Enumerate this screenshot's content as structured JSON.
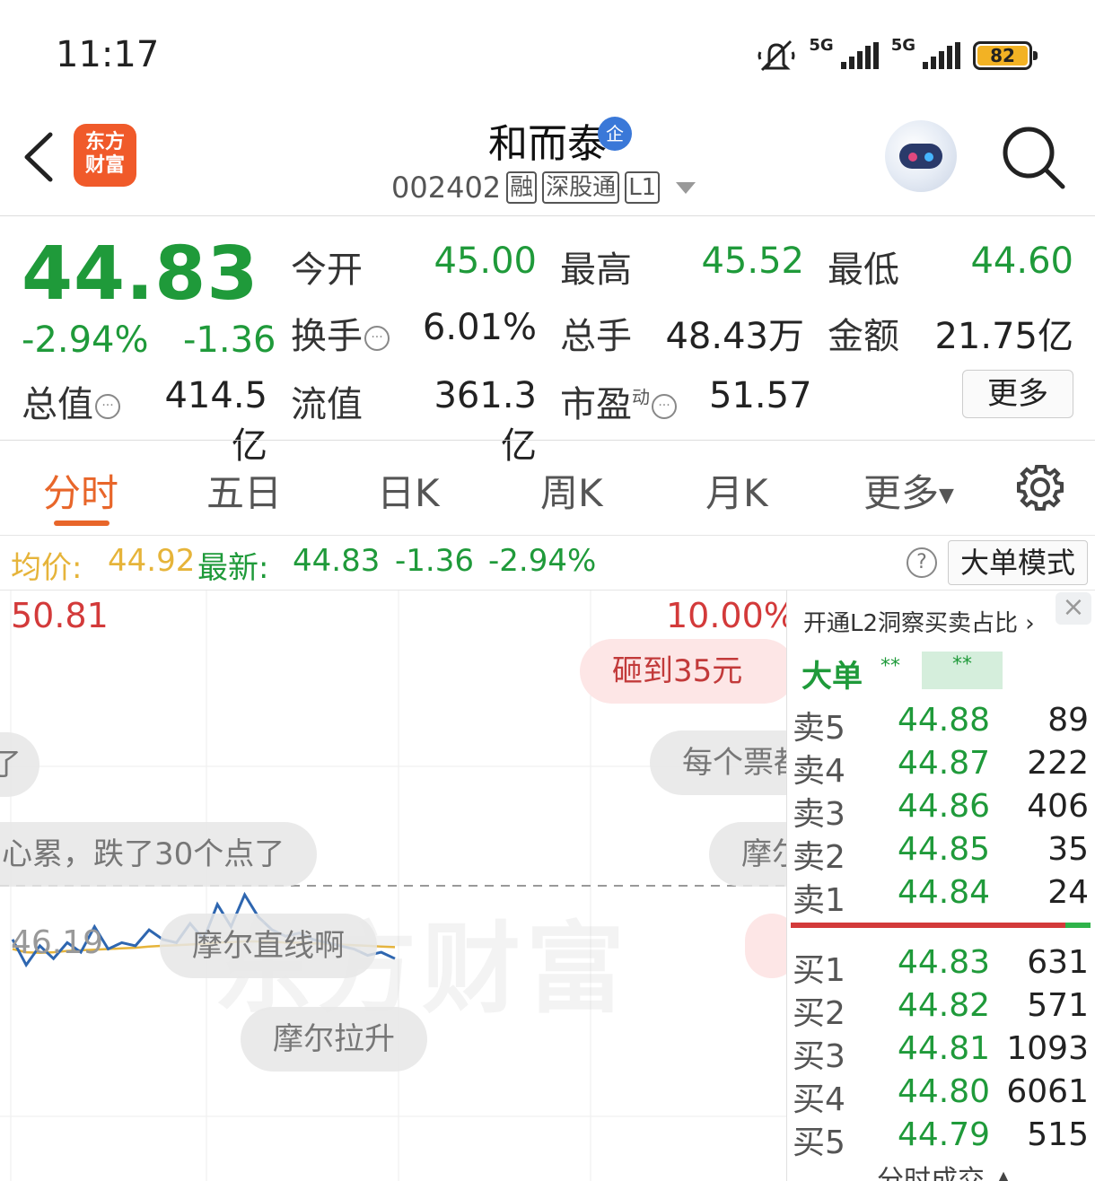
{
  "status": {
    "time": "11:17",
    "net1": "5G",
    "net2": "5G",
    "battery": "82"
  },
  "header": {
    "app_logo": "东方\n财富",
    "stock_name": "和而泰",
    "badge": "企",
    "code": "002402",
    "tags": [
      "融",
      "深股通",
      "L1"
    ]
  },
  "quote": {
    "price": "44.83",
    "pct": "-2.94%",
    "chg": "-1.36",
    "fields": [
      {
        "label": "今开",
        "value": "45.00"
      },
      {
        "label": "最高",
        "value": "45.52"
      },
      {
        "label": "最低",
        "value": "44.60"
      },
      {
        "label": "换手",
        "value": "6.01%"
      },
      {
        "label": "总手",
        "value": "48.43万"
      },
      {
        "label": "金额",
        "value": "21.75亿"
      },
      {
        "label": "总值",
        "value": "414.5亿"
      },
      {
        "label": "流值",
        "value": "361.3亿"
      },
      {
        "label": "市盈",
        "value": "51.57",
        "sup": "动"
      }
    ],
    "more": "更多"
  },
  "tabs": [
    "分时",
    "五日",
    "日K",
    "周K",
    "月K",
    "更多"
  ],
  "infobar": {
    "avg_label": "均价:",
    "avg_value": "44.92",
    "latest_label": "最新:",
    "latest_value": "44.83",
    "chg": "-1.36",
    "pct": "-2.94%",
    "help": "?",
    "bigorder_mode": "大单模式"
  },
  "chart": {
    "top_price": "50.81",
    "top_pct": "10.00%",
    "ref_price": "46.19",
    "watermark": "东方财富",
    "bubbles": [
      "砸到35元",
      "每个票都",
      "心累，跌了30个点了",
      "摩尔直线啊",
      "摩尔",
      "摩尔拉升",
      "了"
    ]
  },
  "chart_data": {
    "type": "line",
    "series": [
      {
        "values": [
          45.35,
          44.95,
          45.25,
          45.05,
          45.3,
          45.15,
          45.55,
          45.2,
          45.3,
          45.25,
          45.5,
          45.35,
          45.3,
          45.6,
          45.35,
          45.9,
          45.55,
          46.05,
          45.7,
          45.5,
          45.4,
          45.45,
          45.35,
          45.3,
          45.25,
          45.2,
          45.1,
          45.15,
          45.05
        ]
      },
      {
        "values": [
          45.2,
          45.15,
          45.14,
          45.15,
          45.17,
          45.18,
          45.19,
          45.2,
          45.21,
          45.22,
          45.24,
          45.25,
          45.26,
          45.27,
          45.28,
          45.3,
          45.31,
          45.32,
          45.32,
          45.32,
          45.3,
          45.3,
          45.29,
          45.28,
          45.27,
          45.26,
          45.25,
          45.24,
          45.23
        ]
      }
    ],
    "ylim": [
      41.57,
      50.81
    ],
    "ref_line": 46.19
  },
  "orderbook": {
    "promo": "开通L2洞察买卖占比",
    "close": "×",
    "bigorder_label": "大单",
    "stars": "**",
    "sell": [
      {
        "label": "卖5",
        "price": "44.88",
        "vol": "89"
      },
      {
        "label": "卖4",
        "price": "44.87",
        "vol": "222"
      },
      {
        "label": "卖3",
        "price": "44.86",
        "vol": "406"
      },
      {
        "label": "卖2",
        "price": "44.85",
        "vol": "35"
      },
      {
        "label": "卖1",
        "price": "44.84",
        "vol": "24"
      }
    ],
    "buy": [
      {
        "label": "买1",
        "price": "44.83",
        "vol": "631"
      },
      {
        "label": "买2",
        "price": "44.82",
        "vol": "571"
      },
      {
        "label": "买3",
        "price": "44.81",
        "vol": "1093"
      },
      {
        "label": "买4",
        "price": "44.80",
        "vol": "6061"
      },
      {
        "label": "买5",
        "price": "44.79",
        "vol": "515"
      }
    ],
    "footer": "分时成交"
  },
  "colors": {
    "down": "#1f9a3a",
    "up": "#d33a3a",
    "accent": "#e8662a",
    "avg_line": "#e6b43a",
    "price_line": "#2e66b0"
  },
  "icons": [
    "back-icon",
    "search-icon",
    "settings-icon",
    "help-icon",
    "close-icon",
    "chevron-right-icon",
    "dropdown-arrow-icon",
    "mute-icon"
  ]
}
